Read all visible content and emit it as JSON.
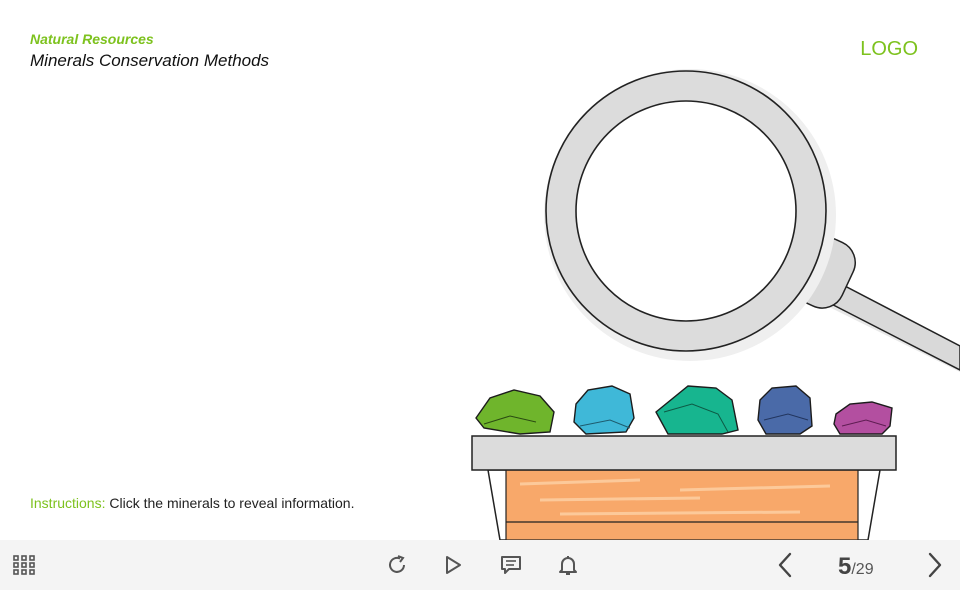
{
  "header": {
    "course_title": "Natural Resources",
    "slide_title": "Minerals Conservation Methods"
  },
  "logo": {
    "text": "LOGO"
  },
  "instructions": {
    "label": "Instructions:",
    "text": " Click the minerals to reveal information."
  },
  "navigation": {
    "current_page": "5",
    "total_pages": "/29"
  },
  "icons": {
    "menu": "grid-icon",
    "replay": "replay-icon",
    "play": "play-icon",
    "notes": "notes-icon",
    "notifications": "bell-icon",
    "prev": "chevron-left-icon",
    "next": "chevron-right-icon"
  },
  "colors": {
    "accent": "#7dc21e",
    "mineral_green": "#6fb52c",
    "mineral_cyan": "#3fb8d8",
    "mineral_teal": "#17b58f",
    "mineral_blue": "#4a6aa8",
    "mineral_magenta": "#b34fa0",
    "box": "#f8a86a"
  }
}
